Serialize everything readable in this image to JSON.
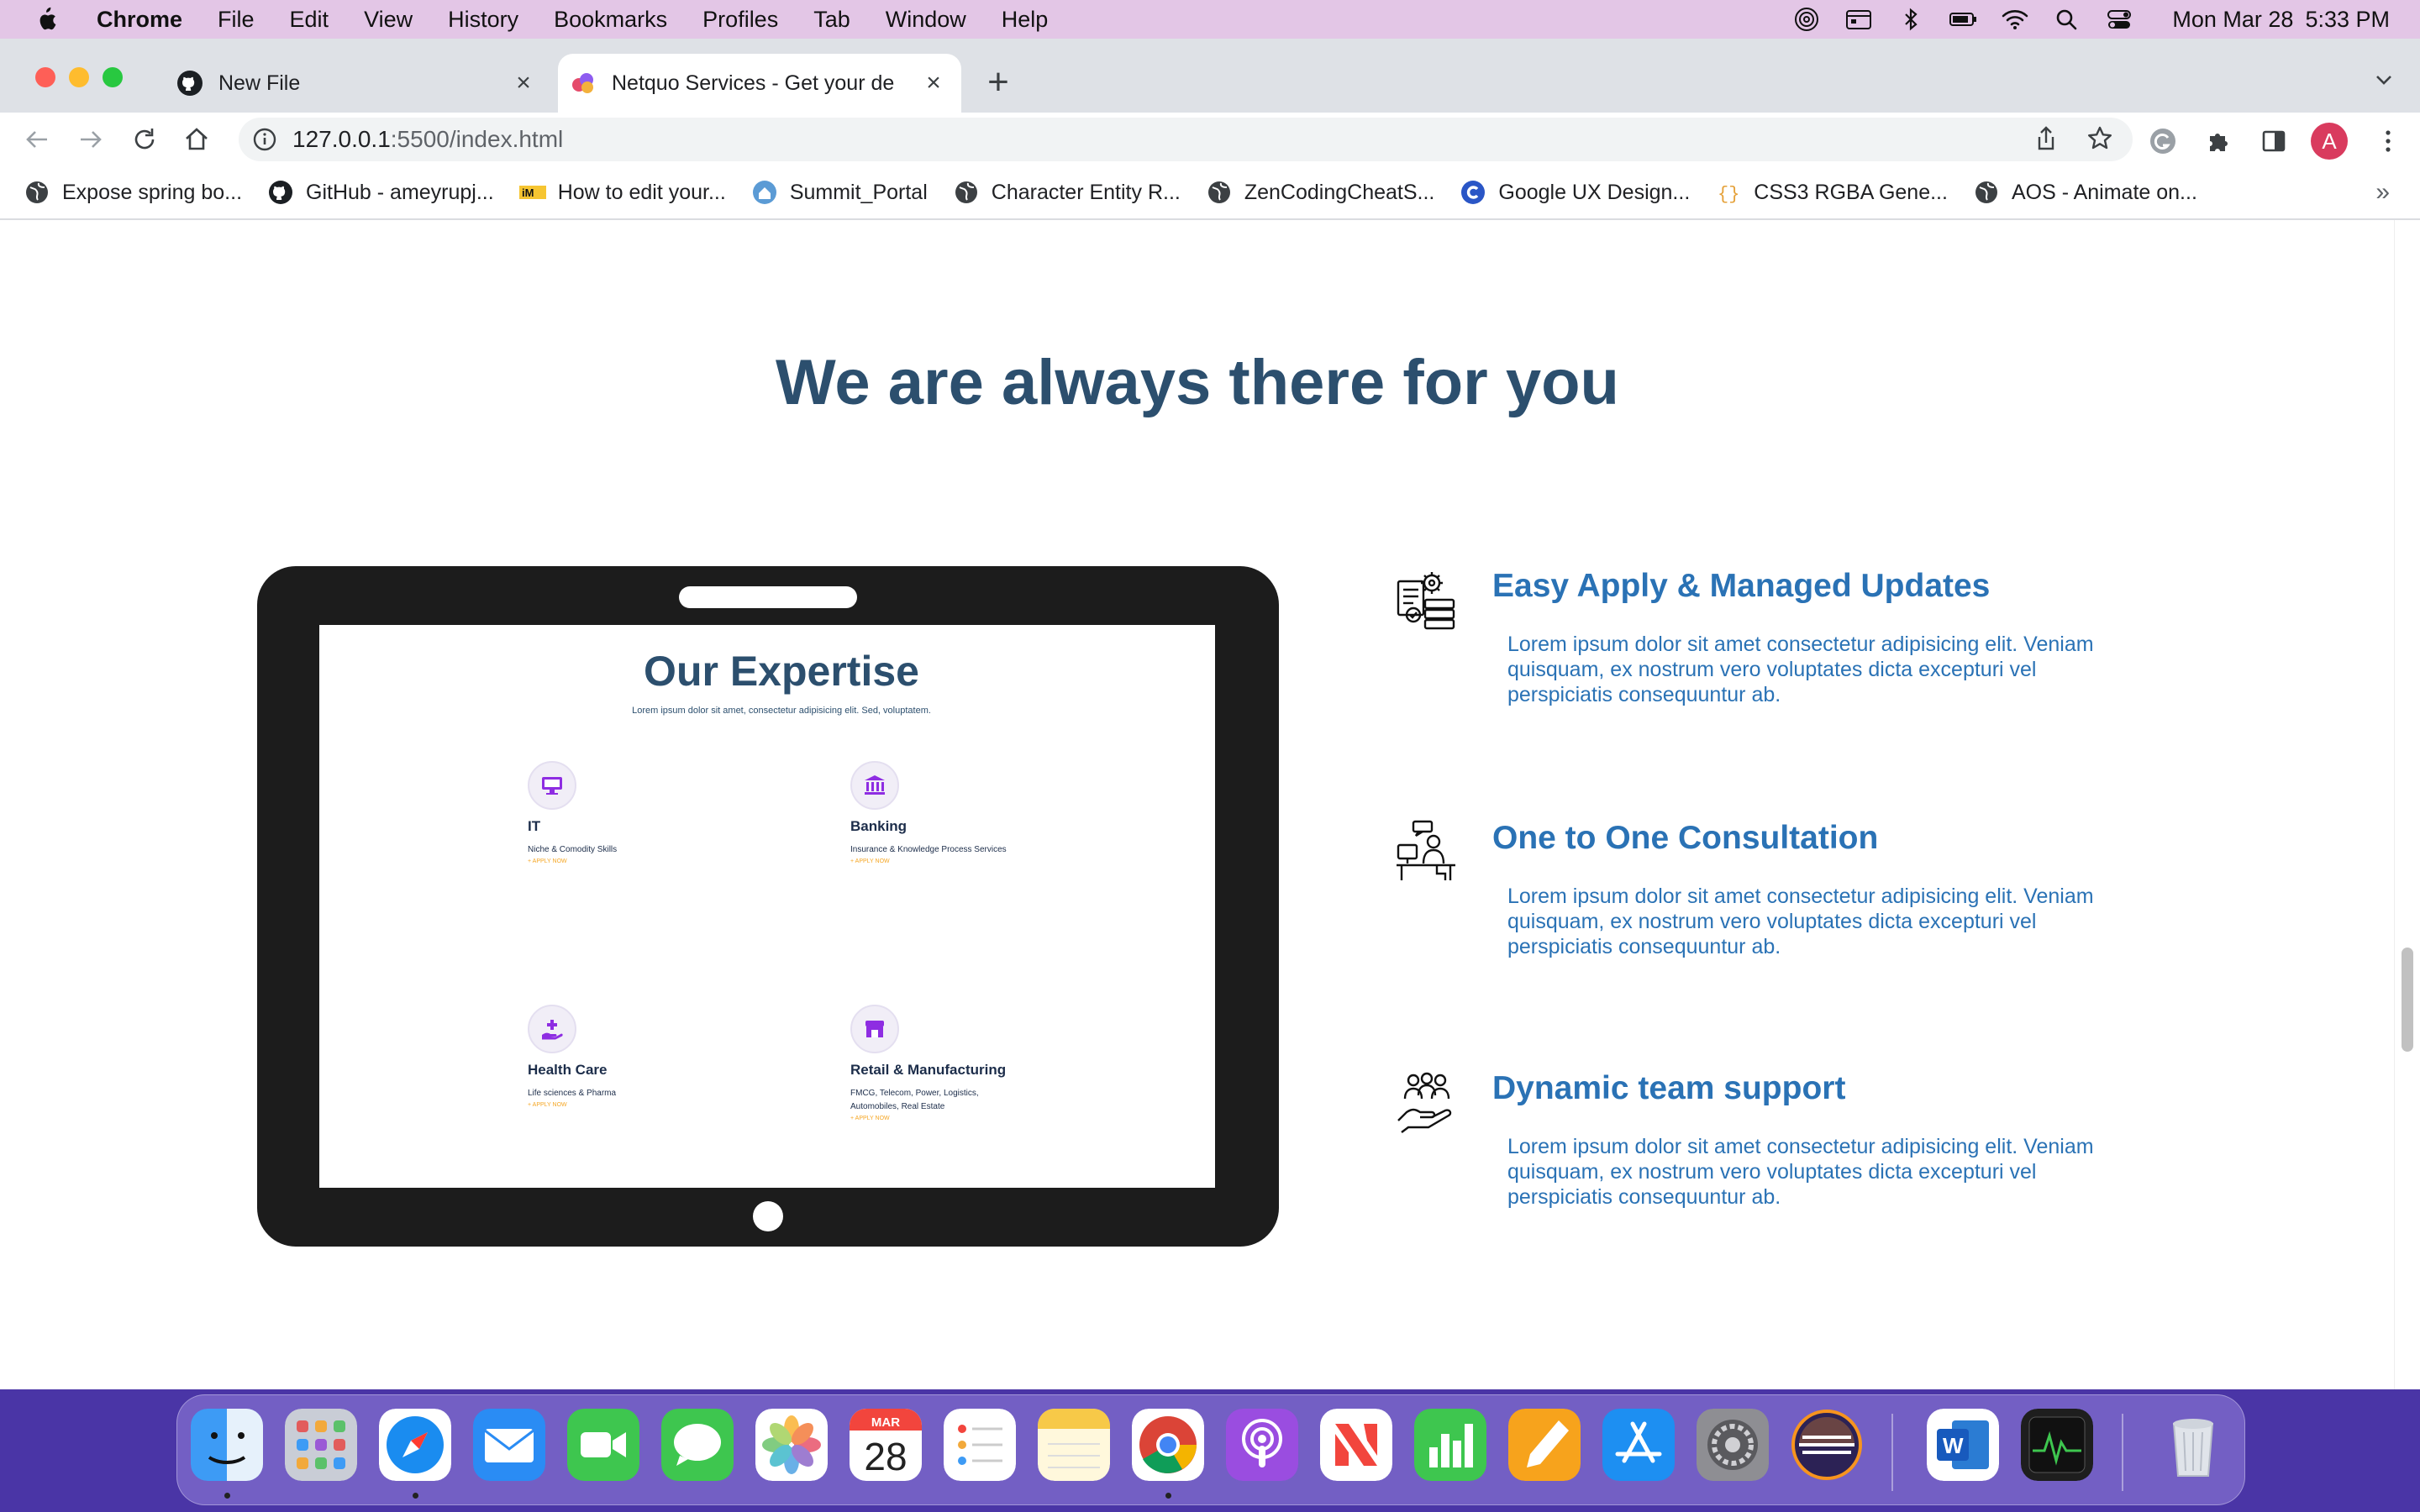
{
  "menubar": {
    "app_name": "Chrome",
    "menus": [
      "File",
      "Edit",
      "View",
      "History",
      "Bookmarks",
      "Profiles",
      "Tab",
      "Window",
      "Help"
    ],
    "clock_day": "Mon Mar 28",
    "clock_time": "5:33 PM"
  },
  "tabs": [
    {
      "title": "New File",
      "icon": "github-icon",
      "active": false
    },
    {
      "title": "Netquo Services - Get your de",
      "icon": "netquo-icon",
      "active": true
    }
  ],
  "address_bar": {
    "url_host": "127.0.0.1",
    "url_path": ":5500/index.html"
  },
  "profile": {
    "initial": "A"
  },
  "bookmarks": [
    {
      "label": "Expose spring bo...",
      "icon": "globe-icon"
    },
    {
      "label": "GitHub - ameyrupj...",
      "icon": "github-icon"
    },
    {
      "label": "How to edit your...",
      "icon": "im-icon"
    },
    {
      "label": "Summit_Portal",
      "icon": "home-badge-icon"
    },
    {
      "label": "Character Entity R...",
      "icon": "globe-icon"
    },
    {
      "label": "ZenCodingCheatS...",
      "icon": "globe-icon"
    },
    {
      "label": "Google UX Design...",
      "icon": "coursera-icon"
    },
    {
      "label": "CSS3 RGBA Gene...",
      "icon": "braces-icon"
    },
    {
      "label": "AOS - Animate on...",
      "icon": "globe-icon"
    }
  ],
  "bookmarks_more": "»",
  "page": {
    "section_title": "We are always there for you",
    "tablet_screen": {
      "title": "Our Expertise",
      "subtitle": "Lorem ipsum dolor sit amet, consectetur adipisicing elit. Sed, voluptatem.",
      "cards": [
        {
          "title": "IT",
          "desc": "Niche & Comodity Skills",
          "link": "+ APPLY NOW",
          "icon": "monitor-icon"
        },
        {
          "title": "Banking",
          "desc": "Insurance & Knowledge Process Services",
          "link": "+ APPLY NOW",
          "icon": "bank-icon"
        },
        {
          "title": "Health Care",
          "desc": "Life sciences & Pharma",
          "link": "+ APPLY NOW",
          "icon": "hand-plus-icon"
        },
        {
          "title": "Retail & Manufacturing",
          "desc": "FMCG, Telecom, Power, Logistics, Automobiles, Real Estate",
          "link": "+ APPLY NOW",
          "icon": "store-icon"
        }
      ]
    },
    "features": [
      {
        "title": "Easy Apply & Managed Updates",
        "text": "Lorem ipsum dolor sit amet consectetur adipisicing elit. Veniam quisquam, ex nostrum vero voluptates dicta excepturi vel perspiciatis consequuntur ab.",
        "icon": "gear-documents-icon"
      },
      {
        "title": "One to One Consultation",
        "text": "Lorem ipsum dolor sit amet consectetur adipisicing elit. Veniam quisquam, ex nostrum vero voluptates dicta excepturi vel perspiciatis consequuntur ab.",
        "icon": "consultation-desk-icon"
      },
      {
        "title": "Dynamic team support",
        "text": "Lorem ipsum dolor sit amet consectetur adipisicing elit. Veniam quisquam, ex nostrum vero voluptates dicta excepturi vel perspiciatis consequuntur ab.",
        "icon": "team-hand-icon"
      }
    ]
  },
  "dock": {
    "apps": [
      "Finder",
      "Launchpad",
      "Safari",
      "Mail",
      "FaceTime",
      "Messages",
      "Photos",
      "Calendar",
      "Reminders",
      "Notes",
      "Chrome",
      "Podcasts",
      "News",
      "Numbers",
      "Pages",
      "App Store",
      "System Preferences",
      "Eclipse",
      "Word",
      "Activity Monitor",
      "Trash"
    ],
    "calendar_month": "MAR",
    "calendar_day": "28"
  }
}
